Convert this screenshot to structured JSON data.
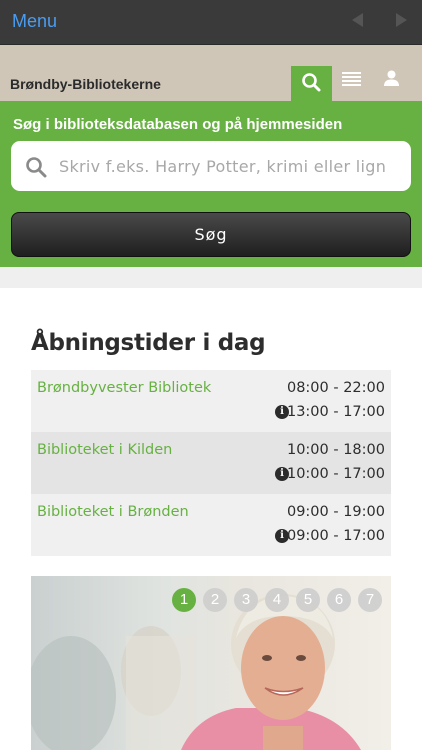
{
  "topbar": {
    "menu_label": "Menu"
  },
  "header": {
    "site_title": "Brøndby-Bibliotekerne"
  },
  "search": {
    "heading": "Søg i biblioteksdatabasen og på hjemmesiden",
    "placeholder": "Skriv f.eks. Harry Potter, krimi eller lign",
    "value": "",
    "button_label": "Søg"
  },
  "hours": {
    "title": "Åbningstider i dag",
    "rows": [
      {
        "name": "Brøndbyvester Bibliotek",
        "time_main": "08:00 - 22:00",
        "time_staffed": "13:00 - 17:00"
      },
      {
        "name": "Biblioteket i Kilden",
        "time_main": "10:00 - 18:00",
        "time_staffed": "10:00 - 17:00"
      },
      {
        "name": "Biblioteket i Brønden",
        "time_main": "09:00 - 19:00",
        "time_staffed": "09:00 - 17:00"
      }
    ]
  },
  "slideshow": {
    "pages": [
      "1",
      "2",
      "3",
      "4",
      "5",
      "6",
      "7"
    ],
    "active_page": 1
  },
  "colors": {
    "accent": "#67b142",
    "header_bg": "#cfc6b8",
    "topbar_bg": "#3a3a3a",
    "link_blue": "#4a9cf0"
  },
  "icons": [
    "search-icon",
    "list-icon",
    "user-icon",
    "info-icon",
    "back-arrow-icon",
    "forward-arrow-icon"
  ]
}
